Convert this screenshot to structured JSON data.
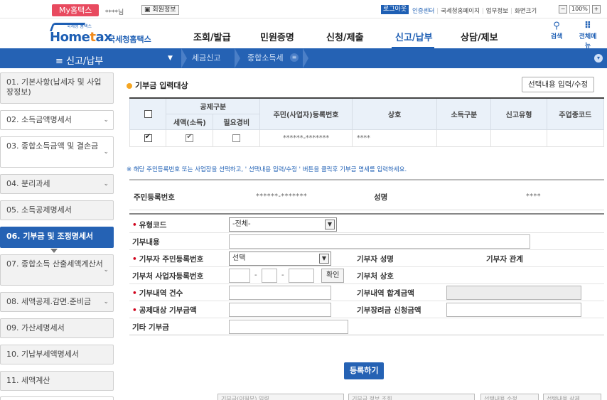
{
  "util": {
    "my_tab": "My홈택스",
    "user_masked": "****님",
    "user_info": "회원정보",
    "logout": "로그아웃",
    "links": [
      "인증센터",
      "국세청홈페이지",
      "업무정보",
      "화면크기"
    ],
    "zoom": "100%"
  },
  "logo": {
    "brand": "Hometax",
    "brand_sub": "국세청홈택스",
    "tiny": "국세청 홈택스"
  },
  "gnb": {
    "menus": [
      "조회/발급",
      "민원증명",
      "신청/제출",
      "신고/납부",
      "상담/제보"
    ],
    "search_label": "검색",
    "allmenu_label": "전체메뉴"
  },
  "lnb": {
    "title": "신고/납부",
    "crumbs": [
      "세금신고",
      "종합소득세"
    ]
  },
  "steps": [
    "01. 기본사항(납세자 및 사업장정보)",
    "02. 소득금액명세서",
    "03. 종합소득금액 및 결손금",
    "04. 분리과세",
    "05. 소득공제명세서",
    "06. 기부금 및 조정명세서",
    "07. 종합소득 산출세액계산서",
    "08. 세액공제.감면.준비금",
    "09. 가산세명세서",
    "10. 기납부세액명세서",
    "11. 세액계산"
  ],
  "section": {
    "title": "기부금 입력대상",
    "select_btn": "선택내용 입력/수정"
  },
  "grid": {
    "headers": {
      "deduction_group": "공제구분",
      "tax_credit": "세액(소득)",
      "expense": "필요경비",
      "reg_no": "주민(사업자)등록번호",
      "name": "상호",
      "income_type": "소득구분",
      "report_type": "신고유형",
      "industry_code": "주업종코드"
    },
    "row": {
      "reg_no": "******-*******",
      "name": "****"
    }
  },
  "notice": "※ 해당 주민등록번호 또는 사업장을 선택하고, ' 선택내용 입력/수정 ' 버튼을 클릭후 기부금 명세를 입력하세요.",
  "info": {
    "reg_label": "주민등록번호",
    "reg_value": "******-*******",
    "name_label": "성명",
    "name_value": "****"
  },
  "form": {
    "type_code": "유형코드",
    "type_code_value": "-전체-",
    "content": "기부내용",
    "donor_reg": "기부자 주민등록번호",
    "donor_reg_value": "선택",
    "donor_name": "기부자 성명",
    "donor_relation": "기부자 관계",
    "org_bizno": "기부처 사업자등록번호",
    "confirm": "확인",
    "org_name": "기부처 상호",
    "count": "기부내역 건수",
    "total": "기부내역 합계금액",
    "eligible": "공제대상 기부금액",
    "incentive": "기부장려금 신청금액",
    "other": "기타 기부금"
  },
  "register_btn": "등록하기",
  "bottom_btns": [
    "기부금(이월분) 입력",
    "기부금 정보 조회",
    "선택내용 수정",
    "선택내용 삭제"
  ]
}
